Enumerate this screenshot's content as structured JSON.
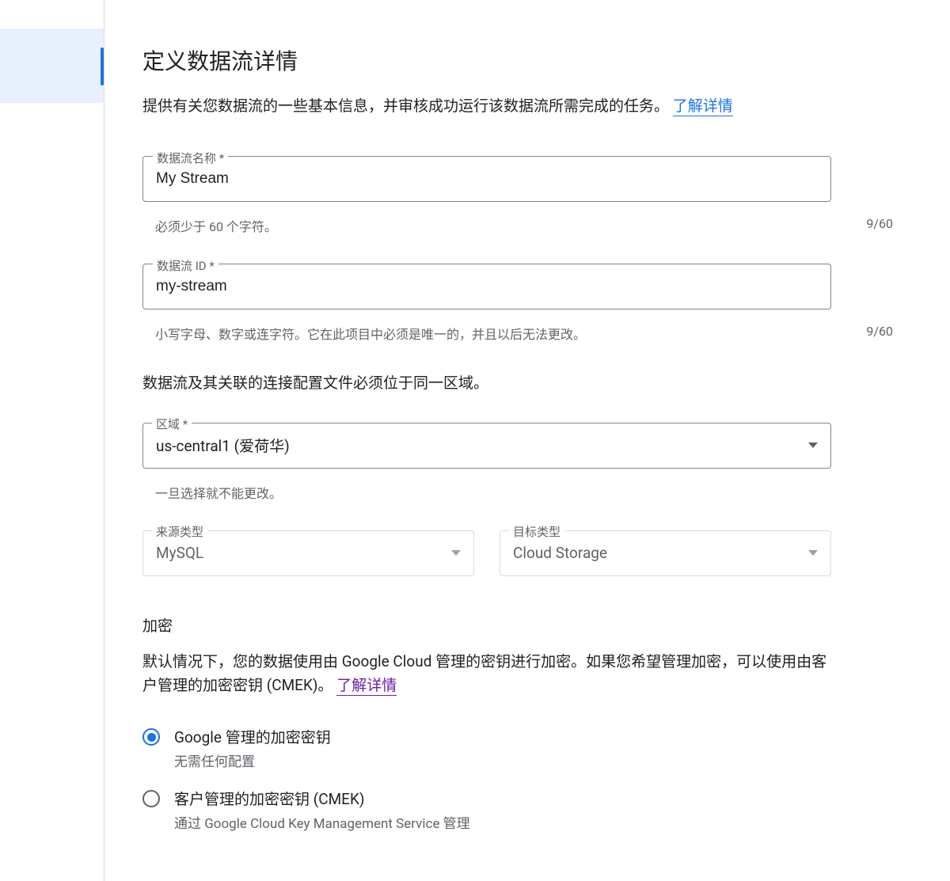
{
  "page": {
    "title": "定义数据流详情",
    "intro": "提供有关您数据流的一些基本信息，并审核成功运行该数据流所需完成的任务。",
    "learn_more": "了解详情"
  },
  "stream_name": {
    "label": "数据流名称 *",
    "value": "My Stream",
    "helper": "必须少于 60 个字符。",
    "counter": "9/60"
  },
  "stream_id": {
    "label": "数据流 ID *",
    "value": "my-stream",
    "helper": "小写字母、数字或连字符。它在此项目中必须是唯一的，并且以后无法更改。",
    "counter": "9/60"
  },
  "region_note": "数据流及其关联的连接配置文件必须位于同一区域。",
  "region": {
    "label": "区域 *",
    "value": "us-central1 (爱荷华)",
    "helper": "一旦选择就不能更改。"
  },
  "source_type": {
    "label": "来源类型",
    "value": "MySQL"
  },
  "dest_type": {
    "label": "目标类型",
    "value": "Cloud Storage"
  },
  "encryption": {
    "title": "加密",
    "desc": "默认情况下，您的数据使用由 Google Cloud 管理的密钥进行加密。如果您希望管理加密，可以使用由客户管理的加密密钥 (CMEK)。",
    "learn_more": "了解详情",
    "opt_google": {
      "label": "Google 管理的加密密钥",
      "sub": "无需任何配置"
    },
    "opt_cmek": {
      "label": "客户管理的加密密钥 (CMEK)",
      "sub": "通过 Google Cloud Key Management Service 管理"
    }
  }
}
